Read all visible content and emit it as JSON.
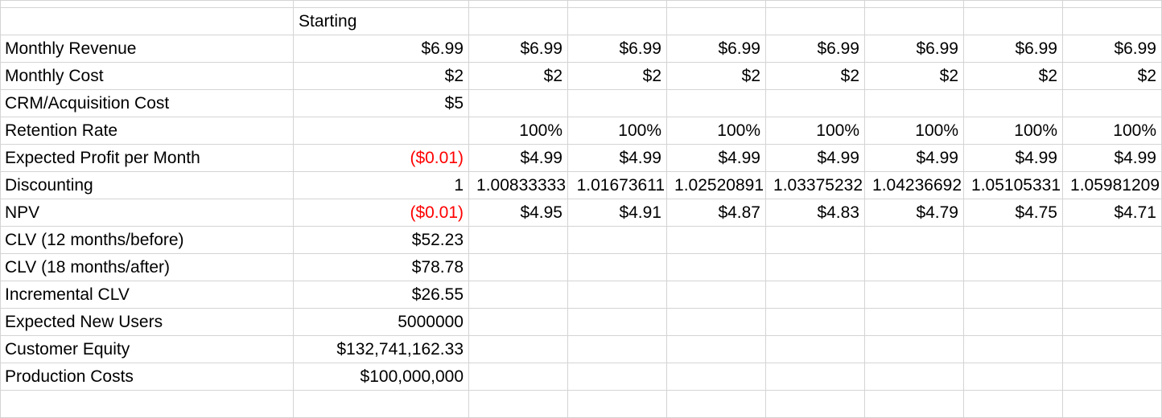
{
  "header": {
    "starting_label": "Starting"
  },
  "colors": {
    "negative": "#ff0000",
    "gridline": "#d4d4d4"
  },
  "rows": {
    "monthly_revenue": {
      "label": "Monthly Revenue",
      "values": [
        "$6.99",
        "$6.99",
        "$6.99",
        "$6.99",
        "$6.99",
        "$6.99",
        "$6.99",
        "$6.99"
      ]
    },
    "monthly_cost": {
      "label": "Monthly Cost",
      "values": [
        "$2",
        "$2",
        "$2",
        "$2",
        "$2",
        "$2",
        "$2",
        "$2"
      ]
    },
    "crm_cost": {
      "label": "CRM/Acquisition Cost",
      "values": [
        "$5"
      ]
    },
    "retention_rate": {
      "label": "Retention Rate",
      "values": [
        "",
        "100%",
        "100%",
        "100%",
        "100%",
        "100%",
        "100%",
        "100%"
      ]
    },
    "expected_profit": {
      "label": "Expected Profit per Month",
      "values": [
        "($0.01)",
        "$4.99",
        "$4.99",
        "$4.99",
        "$4.99",
        "$4.99",
        "$4.99",
        "$4.99"
      ]
    },
    "discounting": {
      "label": "Discounting",
      "values": [
        "1",
        "1.00833333",
        "1.01673611",
        "1.02520891",
        "1.03375232",
        "1.04236692",
        "1.05105331",
        "1.05981209"
      ]
    },
    "npv": {
      "label": "NPV",
      "values": [
        "($0.01)",
        "$4.95",
        "$4.91",
        "$4.87",
        "$4.83",
        "$4.79",
        "$4.75",
        "$4.71"
      ]
    },
    "clv_before": {
      "label": "CLV (12 months/before)",
      "value": "$52.23"
    },
    "clv_after": {
      "label": "CLV (18 months/after)",
      "value": "$78.78"
    },
    "incremental_clv": {
      "label": "Incremental CLV",
      "value": "$26.55"
    },
    "expected_new_users": {
      "label": "Expected New Users",
      "value": "5000000"
    },
    "customer_equity": {
      "label": "Customer Equity",
      "value": "$132,741,162.33"
    },
    "production_costs": {
      "label": "Production Costs",
      "value": "$100,000,000"
    }
  }
}
